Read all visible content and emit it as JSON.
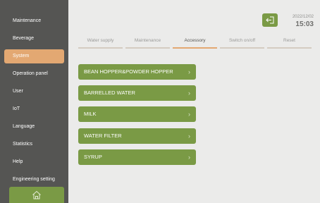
{
  "sidebar": {
    "items": [
      {
        "label": "Maintenance"
      },
      {
        "label": "Beverage"
      },
      {
        "label": "System"
      },
      {
        "label": "Operation panel"
      },
      {
        "label": "User"
      },
      {
        "label": "IoT"
      },
      {
        "label": "Language"
      },
      {
        "label": "Statistics"
      },
      {
        "label": "Help"
      },
      {
        "label": "Engineering setting"
      }
    ],
    "active_index": 2,
    "home_icon": "home-icon"
  },
  "header": {
    "date": "2022/12/02",
    "time": "15:03",
    "door_icon": "exit-door-icon"
  },
  "tabs": [
    {
      "label": "Water supply"
    },
    {
      "label": "Maintenance"
    },
    {
      "label": "Accessory"
    },
    {
      "label": "Switch on/off"
    },
    {
      "label": "Reset"
    }
  ],
  "active_tab": "Accessory",
  "accessories": [
    {
      "label": "BEAN HOPPER&POWDER HOPPER"
    },
    {
      "label": "BARRELLED WATER"
    },
    {
      "label": "MILK"
    },
    {
      "label": "WATER FILTER"
    },
    {
      "label": "SYRUP"
    }
  ],
  "chevron": "›",
  "colors": {
    "sidebar_bg": "#555553",
    "active_accent": "#e3a872",
    "green_button": "#7a9a45",
    "main_bg": "#ebebea"
  }
}
